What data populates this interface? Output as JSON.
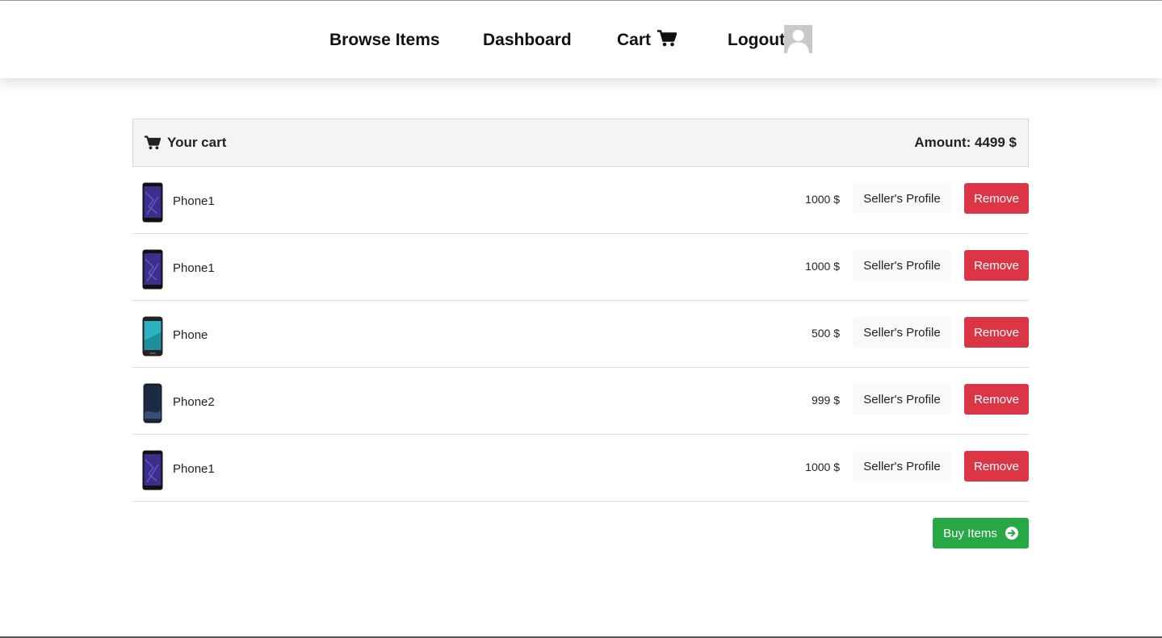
{
  "nav": {
    "browse_label": "Browse Items",
    "dashboard_label": "Dashboard",
    "cart_label": "Cart",
    "logout_label": "Logout",
    "cart_icon": "shopping-cart-icon",
    "avatar_icon": "user-avatar-placeholder"
  },
  "cart": {
    "title": "Your cart",
    "title_icon": "shopping-cart-icon",
    "amount_text": "Amount: 4499 $",
    "items": [
      {
        "name": "Phone1",
        "price": "1000 $",
        "thumb": "dark-purple-phone",
        "seller_label": "Seller's Profile",
        "remove_label": "Remove"
      },
      {
        "name": "Phone1",
        "price": "1000 $",
        "thumb": "dark-purple-phone",
        "seller_label": "Seller's Profile",
        "remove_label": "Remove"
      },
      {
        "name": "Phone",
        "price": "500 $",
        "thumb": "teal-screen-phone",
        "seller_label": "Seller's Profile",
        "remove_label": "Remove"
      },
      {
        "name": "Phone2",
        "price": "999 $",
        "thumb": "dark-blue-phone",
        "seller_label": "Seller's Profile",
        "remove_label": "Remove"
      },
      {
        "name": "Phone1",
        "price": "1000 $",
        "thumb": "dark-purple-phone",
        "seller_label": "Seller's Profile",
        "remove_label": "Remove"
      }
    ],
    "buy_label": "Buy Items",
    "buy_icon": "arrow-circle-right-icon"
  },
  "colors": {
    "remove": "#dc3545",
    "buy": "#28a745",
    "seller_bg": "#f8f9fa",
    "header_bg": "#f4f4f4"
  }
}
